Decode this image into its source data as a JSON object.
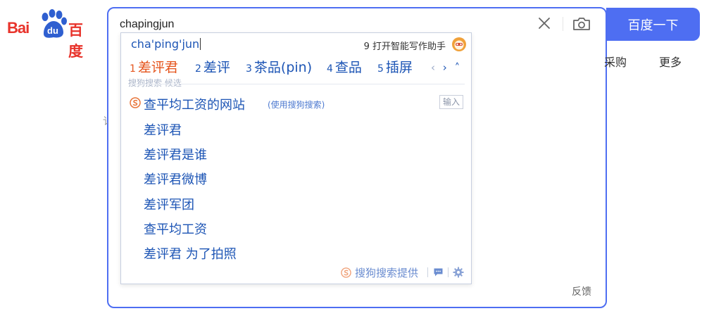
{
  "logo": {
    "text_latin": "Bai",
    "text_badge": "du",
    "text_cn": "百度",
    "brand_color": "#e8332b"
  },
  "search": {
    "value": "chapingjun",
    "button_label": "百度一下",
    "accent": "#4e6ef2"
  },
  "nav": {
    "purchase": "采购",
    "more": "更多"
  },
  "background": {
    "partial_char": "讠"
  },
  "feedback": "反馈",
  "ime": {
    "pinyin": "cha'ping'jun",
    "assistant_label": "9 打开智能写作助手",
    "candidates": [
      {
        "num": "1",
        "word": "差评君"
      },
      {
        "num": "2",
        "word": "差评"
      },
      {
        "num": "3",
        "word": "茶品(pin)"
      },
      {
        "num": "4",
        "word": "查品"
      },
      {
        "num": "5",
        "word": "插屏"
      }
    ],
    "pager": {
      "prev": "‹",
      "next": "›",
      "collapse": "˄"
    },
    "source_label": "搜狗搜索 候选",
    "top_suggestion": "查平均工资的网站",
    "top_suggestion_hint": "(使用搜狗搜索)",
    "input_badge": "输入",
    "suggestions": [
      "差评君",
      "差评君是谁",
      "差评君微博",
      "差评军团",
      "查平均工资",
      "差评君 为了拍照"
    ],
    "footer_provider": "搜狗搜索提供",
    "link_color": "#1d55b5",
    "highlight_color": "#e5541c"
  }
}
